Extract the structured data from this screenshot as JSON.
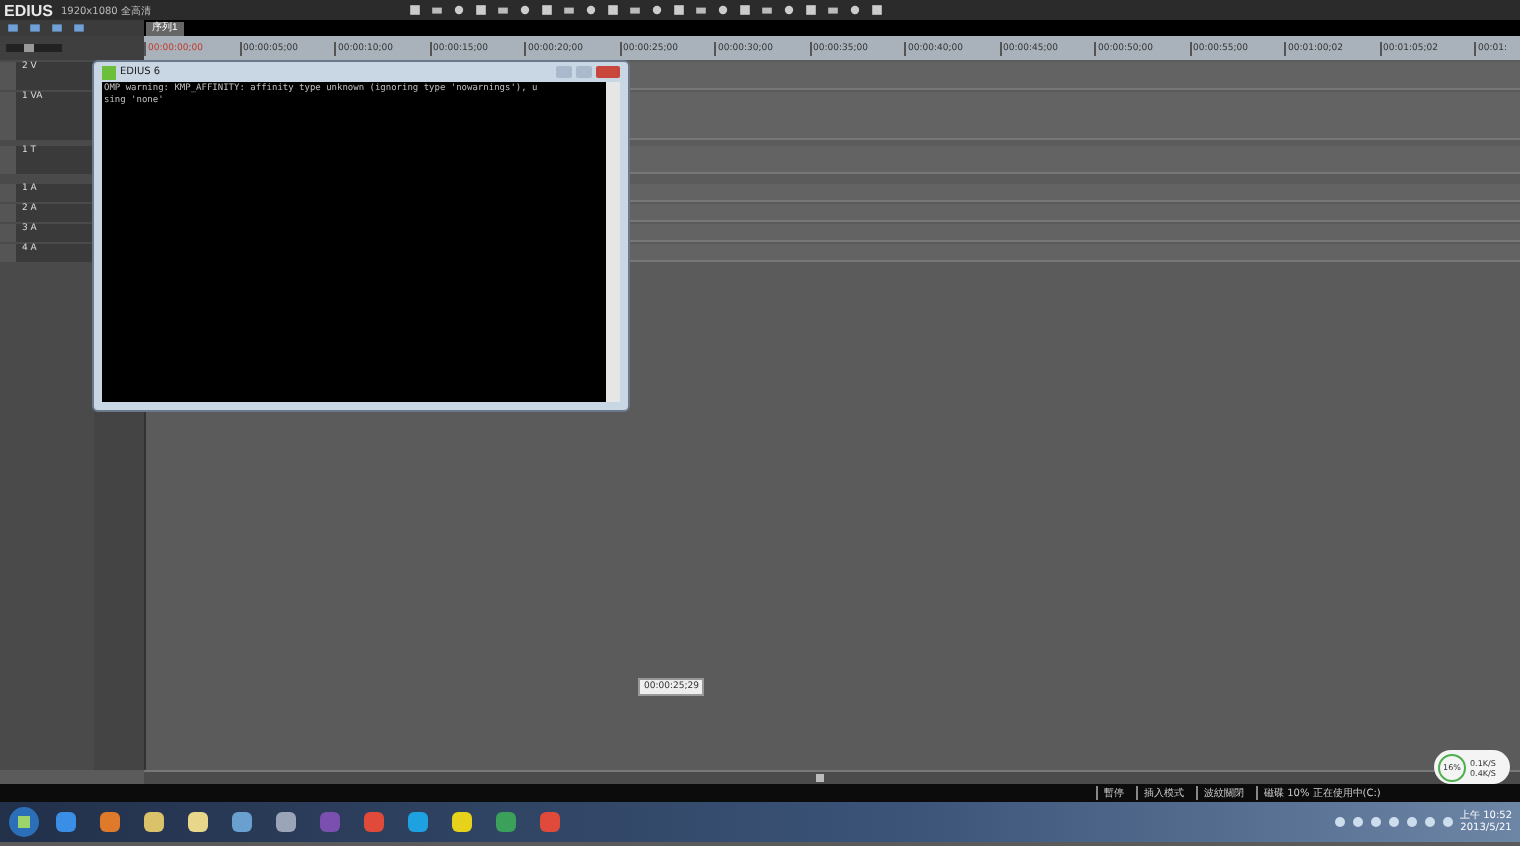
{
  "app": {
    "logo": "EDIUS",
    "project": "1920x1080 全高清"
  },
  "zoom_slider": {
    "level": 0.4
  },
  "sequence_tab": {
    "label": "序列1",
    "selected": true
  },
  "ruler": [
    "00:00:00;00",
    "00:00:05;00",
    "00:00:10;00",
    "00:00:15;00",
    "00:00:20;00",
    "00:00:25;00",
    "00:00:30;00",
    "00:00:35;00",
    "00:00:40;00",
    "00:00:45;00",
    "00:00:50;00",
    "00:00:55;00",
    "00:01:00;02",
    "00:01:05;02",
    "00:01:"
  ],
  "tracks": [
    {
      "name": "2 V",
      "kind": "video"
    },
    {
      "name": "1 VA",
      "kind": "videoaudio"
    },
    {
      "name": "1 T",
      "kind": "title"
    },
    {
      "name": "1 A",
      "kind": "audio"
    },
    {
      "name": "2 A",
      "kind": "audio"
    },
    {
      "name": "3 A",
      "kind": "audio"
    },
    {
      "name": "4 A",
      "kind": "audio"
    }
  ],
  "console": {
    "title": "EDIUS 6",
    "lines": [
      "OMP warning: KMP_AFFINITY: affinity type unknown (ignoring type 'nowarnings'), u",
      "sing 'none'"
    ]
  },
  "tooltip": "00:00:25;29",
  "status_bar": [
    "暫停",
    "插入模式",
    "波紋關閉",
    "磁碟 10% 正在使用中(C:)"
  ],
  "net_widget": {
    "percent": "16%",
    "up": "0.1K/S",
    "down": "0.4K/S"
  },
  "clock": {
    "time": "上午 10:52",
    "date": "2013/5/21"
  }
}
